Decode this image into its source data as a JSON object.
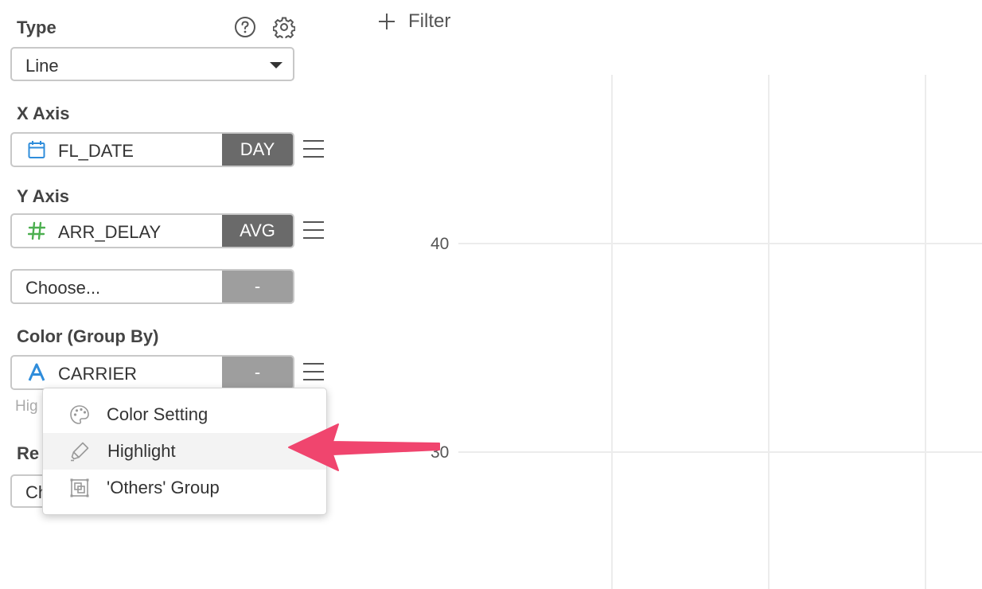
{
  "sidebar": {
    "type": {
      "label": "Type",
      "value": "Line"
    },
    "x_axis": {
      "label": "X Axis",
      "field": "FL_DATE",
      "aggregation": "DAY",
      "icon": "calendar-icon"
    },
    "y_axis": {
      "label": "Y Axis",
      "field": "ARR_DELAY",
      "aggregation": "AVG",
      "icon": "number-icon"
    },
    "y_axis_extra": {
      "placeholder": "Choose...",
      "aggregation": "-"
    },
    "color": {
      "label": "Color (Group By)",
      "field": "CARRIER",
      "aggregation": "-",
      "icon": "text-type-icon"
    },
    "hint": "Hig",
    "repeat": {
      "label": "Re",
      "value": "Ch"
    }
  },
  "menu": {
    "items": [
      {
        "label": "Color Setting",
        "icon": "palette-icon"
      },
      {
        "label": "Highlight",
        "icon": "highlighter-icon"
      },
      {
        "label": "'Others' Group",
        "icon": "others-group-icon"
      }
    ],
    "active_index": 1
  },
  "toolbar": {
    "filter_label": "Filter"
  },
  "chart_data": {
    "type": "line",
    "y_ticks": [
      "40",
      "30"
    ],
    "grid": true
  },
  "colors": {
    "accent_pink": "#f0456e",
    "calendar_blue": "#2f8ddb",
    "number_green": "#4caf50",
    "text_blue": "#2f8ddb",
    "agg_dark": "#6a6a6a",
    "agg_light": "#9e9e9e"
  }
}
